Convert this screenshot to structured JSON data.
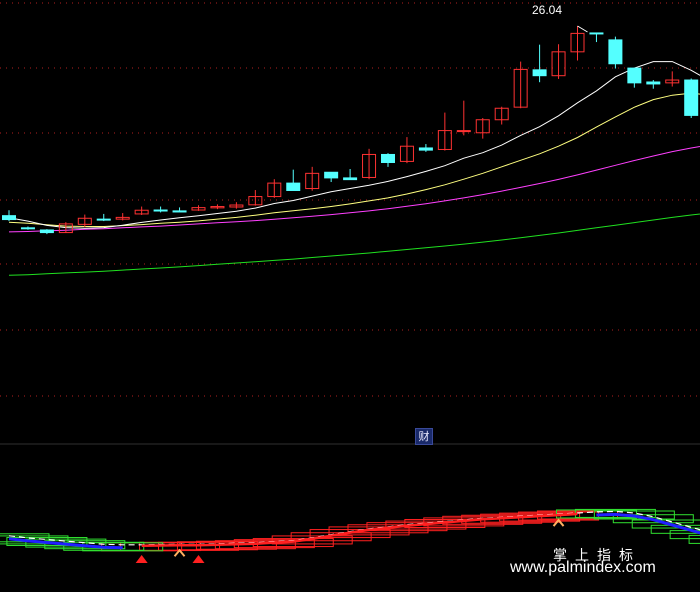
{
  "chart_data": [
    {
      "type": "candlestick",
      "panel": "main",
      "high_label": "26.04",
      "ylim": [
        12.3,
        26.4
      ],
      "colors": {
        "up": "#ff3232",
        "down": "#54ffff",
        "ma5": "#ffffff",
        "ma10": "#ffff80",
        "ma20": "#ff40ff",
        "ma60": "#20e020",
        "grid": "#b02020"
      },
      "candles": [
        {
          "o": 17.3,
          "h": 17.55,
          "l": 17.05,
          "c": 17.12
        },
        {
          "o": 16.74,
          "h": 16.8,
          "l": 16.65,
          "c": 16.7
        },
        {
          "o": 16.64,
          "h": 16.68,
          "l": 16.45,
          "c": 16.52
        },
        {
          "o": 16.52,
          "h": 17.0,
          "l": 16.5,
          "c": 16.92
        },
        {
          "o": 16.9,
          "h": 17.35,
          "l": 16.78,
          "c": 17.18
        },
        {
          "o": 17.14,
          "h": 17.38,
          "l": 17.05,
          "c": 17.12
        },
        {
          "o": 17.14,
          "h": 17.42,
          "l": 17.08,
          "c": 17.22
        },
        {
          "o": 17.38,
          "h": 17.72,
          "l": 17.33,
          "c": 17.55
        },
        {
          "o": 17.56,
          "h": 17.72,
          "l": 17.45,
          "c": 17.55
        },
        {
          "o": 17.52,
          "h": 17.68,
          "l": 17.48,
          "c": 17.47
        },
        {
          "o": 17.56,
          "h": 17.78,
          "l": 17.52,
          "c": 17.67
        },
        {
          "o": 17.66,
          "h": 17.82,
          "l": 17.6,
          "c": 17.72
        },
        {
          "o": 17.7,
          "h": 17.92,
          "l": 17.62,
          "c": 17.79
        },
        {
          "o": 17.8,
          "h": 18.48,
          "l": 17.76,
          "c": 18.18
        },
        {
          "o": 18.18,
          "h": 18.98,
          "l": 18.12,
          "c": 18.8
        },
        {
          "o": 18.8,
          "h": 19.42,
          "l": 18.55,
          "c": 18.46
        },
        {
          "o": 18.55,
          "h": 19.55,
          "l": 18.45,
          "c": 19.25
        },
        {
          "o": 19.3,
          "h": 19.3,
          "l": 18.85,
          "c": 19.04
        },
        {
          "o": 19.04,
          "h": 19.45,
          "l": 18.95,
          "c": 18.96
        },
        {
          "o": 19.06,
          "h": 20.38,
          "l": 18.98,
          "c": 20.12
        },
        {
          "o": 20.12,
          "h": 20.18,
          "l": 19.55,
          "c": 19.75
        },
        {
          "o": 19.8,
          "h": 20.92,
          "l": 19.72,
          "c": 20.5
        },
        {
          "o": 20.42,
          "h": 20.6,
          "l": 20.24,
          "c": 20.32
        },
        {
          "o": 20.35,
          "h": 22.05,
          "l": 20.3,
          "c": 21.22
        },
        {
          "o": 21.22,
          "h": 22.6,
          "l": 21.0,
          "c": 21.22
        },
        {
          "o": 21.12,
          "h": 21.8,
          "l": 20.85,
          "c": 21.72
        },
        {
          "o": 21.72,
          "h": 22.32,
          "l": 21.5,
          "c": 22.25
        },
        {
          "o": 22.3,
          "h": 24.4,
          "l": 22.25,
          "c": 24.04
        },
        {
          "o": 24.02,
          "h": 25.18,
          "l": 23.45,
          "c": 23.75
        },
        {
          "o": 23.75,
          "h": 25.2,
          "l": 23.6,
          "c": 24.85
        },
        {
          "o": 24.85,
          "h": 26.04,
          "l": 24.45,
          "c": 25.7
        },
        {
          "o": 25.72,
          "h": 25.72,
          "l": 25.3,
          "c": 25.69
        },
        {
          "o": 25.4,
          "h": 25.55,
          "l": 24.08,
          "c": 24.3
        },
        {
          "o": 24.1,
          "h": 24.1,
          "l": 23.2,
          "c": 23.42
        },
        {
          "o": 23.46,
          "h": 23.55,
          "l": 23.15,
          "c": 23.37
        },
        {
          "o": 23.42,
          "h": 23.95,
          "l": 23.25,
          "c": 23.55
        },
        {
          "o": 23.55,
          "h": 23.62,
          "l": 21.8,
          "c": 21.92
        },
        {
          "o": 21.9,
          "h": 22.05,
          "l": 21.38,
          "c": 21.52
        },
        {
          "o": 21.66,
          "h": 21.92,
          "l": 21.45,
          "c": 21.68
        },
        {
          "o": 21.4,
          "h": 22.05,
          "l": 21.35,
          "c": 21.86
        }
      ],
      "ma5": [
        17.2,
        17.05,
        16.85,
        16.75,
        16.72,
        16.75,
        16.86,
        16.99,
        17.1,
        17.2,
        17.3,
        17.4,
        17.5,
        17.65,
        17.86,
        18.0,
        18.2,
        18.4,
        18.55,
        18.7,
        18.88,
        19.1,
        19.34,
        19.6,
        19.95,
        20.2,
        20.55,
        21.0,
        21.4,
        21.9,
        22.5,
        23.05,
        23.7,
        24.1,
        24.4,
        24.4,
        24.0,
        23.5,
        23.1,
        22.7
      ],
      "ma10": [
        17.0,
        16.95,
        16.88,
        16.82,
        16.8,
        16.8,
        16.84,
        16.89,
        16.95,
        17.0,
        17.06,
        17.14,
        17.22,
        17.32,
        17.43,
        17.53,
        17.62,
        17.72,
        17.84,
        17.98,
        18.12,
        18.3,
        18.5,
        18.72,
        18.98,
        19.25,
        19.55,
        19.85,
        20.15,
        20.5,
        20.9,
        21.38,
        21.85,
        22.3,
        22.65,
        22.85,
        22.95,
        22.85,
        22.55,
        22.2
      ],
      "ma20": [
        16.55,
        16.57,
        16.6,
        16.63,
        16.67,
        16.7,
        16.74,
        16.78,
        16.82,
        16.87,
        16.92,
        16.97,
        17.02,
        17.07,
        17.13,
        17.2,
        17.27,
        17.35,
        17.43,
        17.52,
        17.62,
        17.73,
        17.85,
        17.98,
        18.12,
        18.27,
        18.43,
        18.6,
        18.78,
        18.97,
        19.18,
        19.4,
        19.62,
        19.84,
        20.05,
        20.25,
        20.42,
        20.57,
        20.7,
        20.82
      ],
      "ma60": [
        14.55,
        14.58,
        14.62,
        14.66,
        14.7,
        14.74,
        14.79,
        14.84,
        14.89,
        14.94,
        15.0,
        15.06,
        15.12,
        15.18,
        15.24,
        15.3,
        15.37,
        15.44,
        15.51,
        15.58,
        15.66,
        15.74,
        15.82,
        15.9,
        15.99,
        16.08,
        16.18,
        16.28,
        16.39,
        16.5,
        16.62,
        16.74,
        16.86,
        16.98,
        17.1,
        17.22,
        17.33,
        17.43,
        17.52,
        17.6
      ]
    },
    {
      "type": "indicator",
      "panel": "sub",
      "badge": "财",
      "ylim": [
        0,
        100
      ],
      "line": [
        40,
        36,
        33,
        30,
        27,
        24,
        23,
        23,
        23.5,
        24,
        24,
        25,
        26,
        27,
        29,
        31,
        36,
        42,
        48,
        53,
        57,
        61,
        64,
        67,
        70,
        73,
        75,
        77,
        79,
        81,
        83,
        85,
        86,
        83,
        76,
        66,
        56,
        46,
        37,
        30
      ],
      "up_ranges": [
        [
          7,
          30
        ]
      ],
      "down_ranges": [
        [
          0,
          6
        ],
        [
          31,
          39
        ]
      ],
      "buy_markers": [
        7,
        10
      ],
      "cross_markers": [
        9,
        29
      ],
      "colors": {
        "band_up": "#ff2020",
        "band_down": "#30e030",
        "dashes": "#ffffff",
        "blue": "#2020ff",
        "marker": "#ff2020",
        "cross": "#ffb060"
      }
    }
  ],
  "watermark": {
    "cn": "掌上指标",
    "url": "www.palmindex.com"
  }
}
